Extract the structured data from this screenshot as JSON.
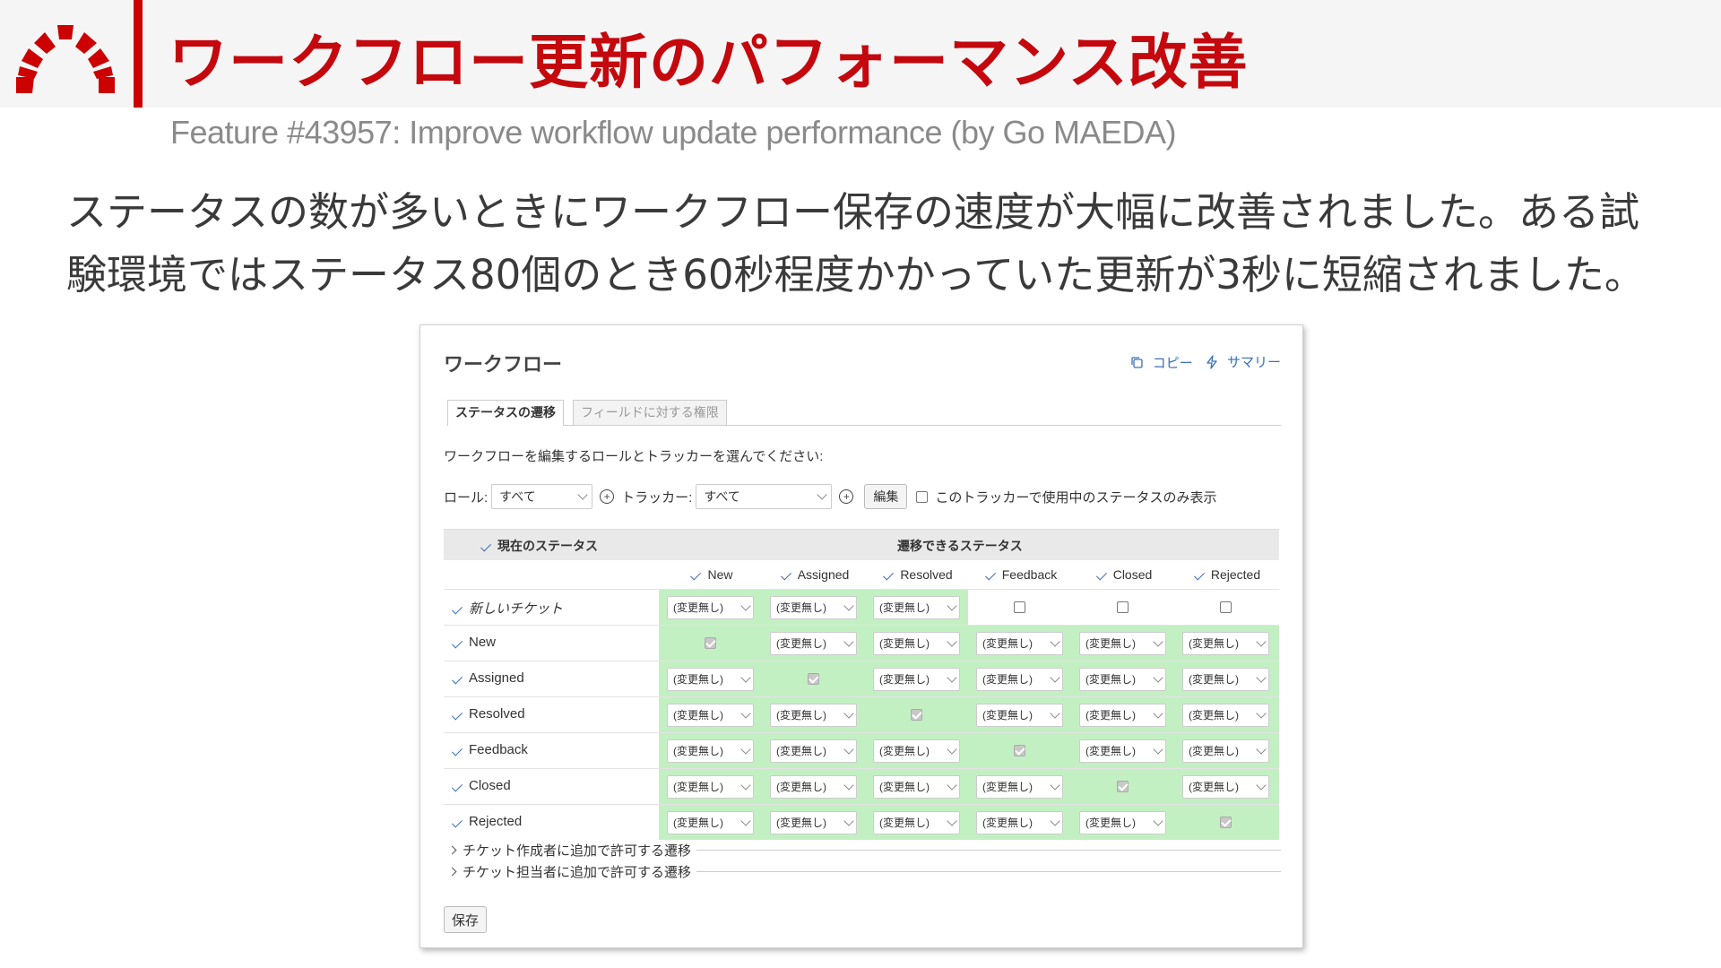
{
  "slide": {
    "title": "ワークフロー更新のパフォーマンス改善",
    "subtitle": "Feature #43957: Improve workflow update performance (by Go MAEDA)",
    "body_line1": "ステータスの数が多いときにワークフロー保存の速度が大幅に改善されました。ある試",
    "body_line2": "験環境ではステータス80個のとき60秒程度かかっていた更新が3秒に短縮されました。"
  },
  "colors": {
    "accent_red": "#c4080d",
    "bar_red": "#cc0000",
    "link_blue": "#3b6fb6",
    "cell_green": "#c3f0c3"
  },
  "workflow": {
    "title": "ワークフロー",
    "copy_link": "コピー",
    "summary_link": "サマリー",
    "tabs": [
      "ステータスの遷移",
      "フィールドに対する権限"
    ],
    "instruction": "ワークフローを編集するロールとトラッカーを選んでください:",
    "role_label": "ロール:",
    "role_value": "すべて",
    "tracker_label": "トラッカー:",
    "tracker_value": "すべて",
    "edit_button": "編集",
    "only_used_label": "このトラッカーで使用中のステータスのみ表示",
    "current_status_header": "現在のステータス",
    "allowed_status_header": "遷移できるステータス",
    "statuses": [
      "New",
      "Assigned",
      "Resolved",
      "Feedback",
      "Closed",
      "Rejected"
    ],
    "new_issue_label": "新しいチケット",
    "no_change": "(変更無し)",
    "extra_author": "チケット作成者に追加で許可する遷移",
    "extra_assignee": "チケット担当者に追加で許可する遷移",
    "save_button": "保存"
  }
}
